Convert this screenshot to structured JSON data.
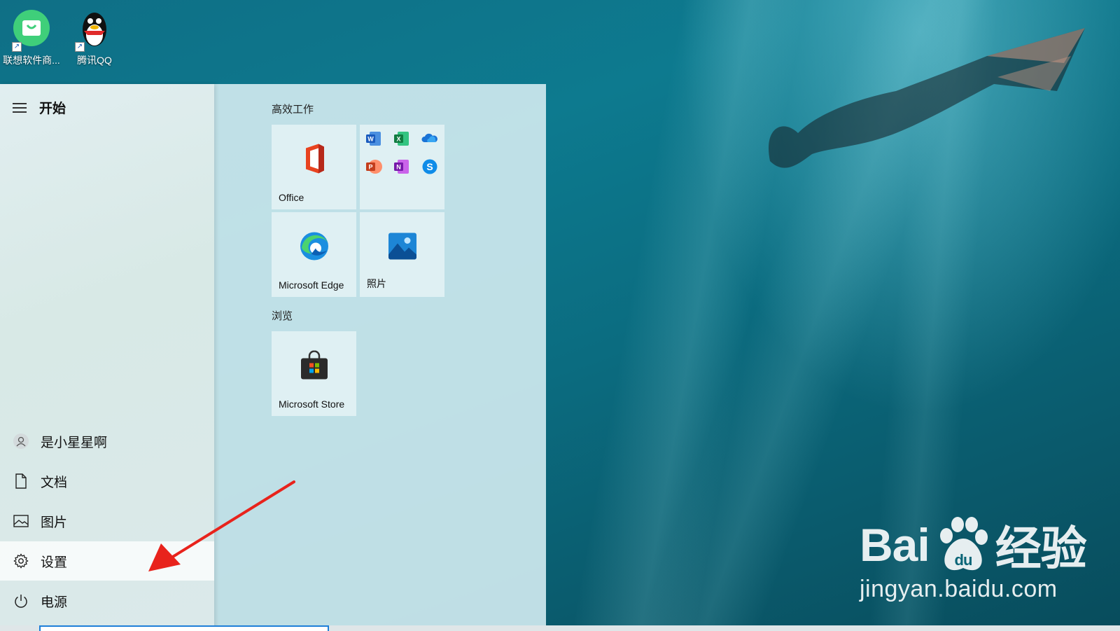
{
  "desktop": {
    "icons": [
      {
        "label": "联想软件商...",
        "icon": "lenovo-store-bag-icon"
      },
      {
        "label": "腾讯QQ",
        "icon": "qq-penguin-icon"
      }
    ]
  },
  "start_menu": {
    "title": "开始",
    "rail_items": [
      {
        "label": "是小星星啊",
        "icon": "user-icon"
      },
      {
        "label": "文档",
        "icon": "document-icon"
      },
      {
        "label": "图片",
        "icon": "pictures-icon"
      },
      {
        "label": "设置",
        "icon": "gear-icon",
        "selected": true
      },
      {
        "label": "电源",
        "icon": "power-icon"
      }
    ],
    "groups": [
      {
        "title": "高效工作",
        "tiles": [
          {
            "label": "Office",
            "icon": "office-icon"
          },
          {
            "label": "",
            "icon": "office-apps-folder-icon",
            "apps": [
              "Word",
              "Excel",
              "OneDrive",
              "PowerPoint",
              "OneNote",
              "Skype"
            ]
          },
          {
            "label": "Microsoft Edge",
            "icon": "edge-icon"
          },
          {
            "label": "照片",
            "icon": "photos-icon"
          }
        ]
      },
      {
        "title": "浏览",
        "tiles": [
          {
            "label": "Microsoft Store",
            "icon": "store-bag-icon"
          }
        ]
      }
    ]
  },
  "watermark": {
    "brand_left": "Bai",
    "brand_right": "经验",
    "url": "jingyan.baidu.com"
  },
  "annotation": {
    "icon": "red-arrow-icon",
    "color": "#e8231c"
  },
  "colors": {
    "accent": "#1e7fd8",
    "arrow": "#e8231c"
  }
}
